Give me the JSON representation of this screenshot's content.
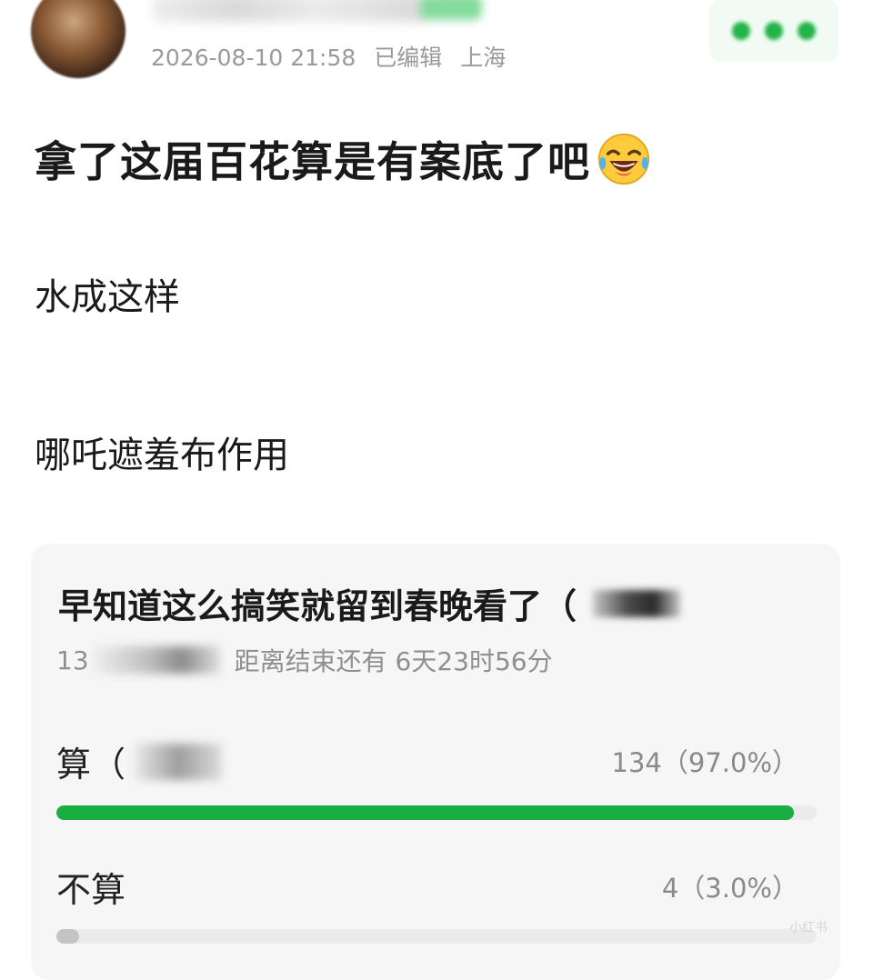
{
  "post": {
    "timestamp": "2026-08-10 21:58",
    "edited": "已编辑",
    "location": "上海",
    "title": "拿了这届百花算是有案底了吧",
    "title_emoji": "face-with-tears-of-joy",
    "lines": [
      "水成这样",
      "哪吒遮羞布作用"
    ]
  },
  "poll": {
    "question": "早知道这么搞笑就留到春晚看了（",
    "count_prefix": "13",
    "remaining": "距离结束还有 6天23时56分",
    "options": [
      {
        "label": "算（",
        "result": "134（97.0%）",
        "percent": 97.0
      },
      {
        "label": "不算",
        "result": "4（3.0%）",
        "percent": 3.0
      }
    ]
  },
  "watermark": "小红书",
  "colors": {
    "accent": "#1aad3f",
    "muted": "#9a9a9a",
    "card_bg": "#f6f6f6"
  }
}
